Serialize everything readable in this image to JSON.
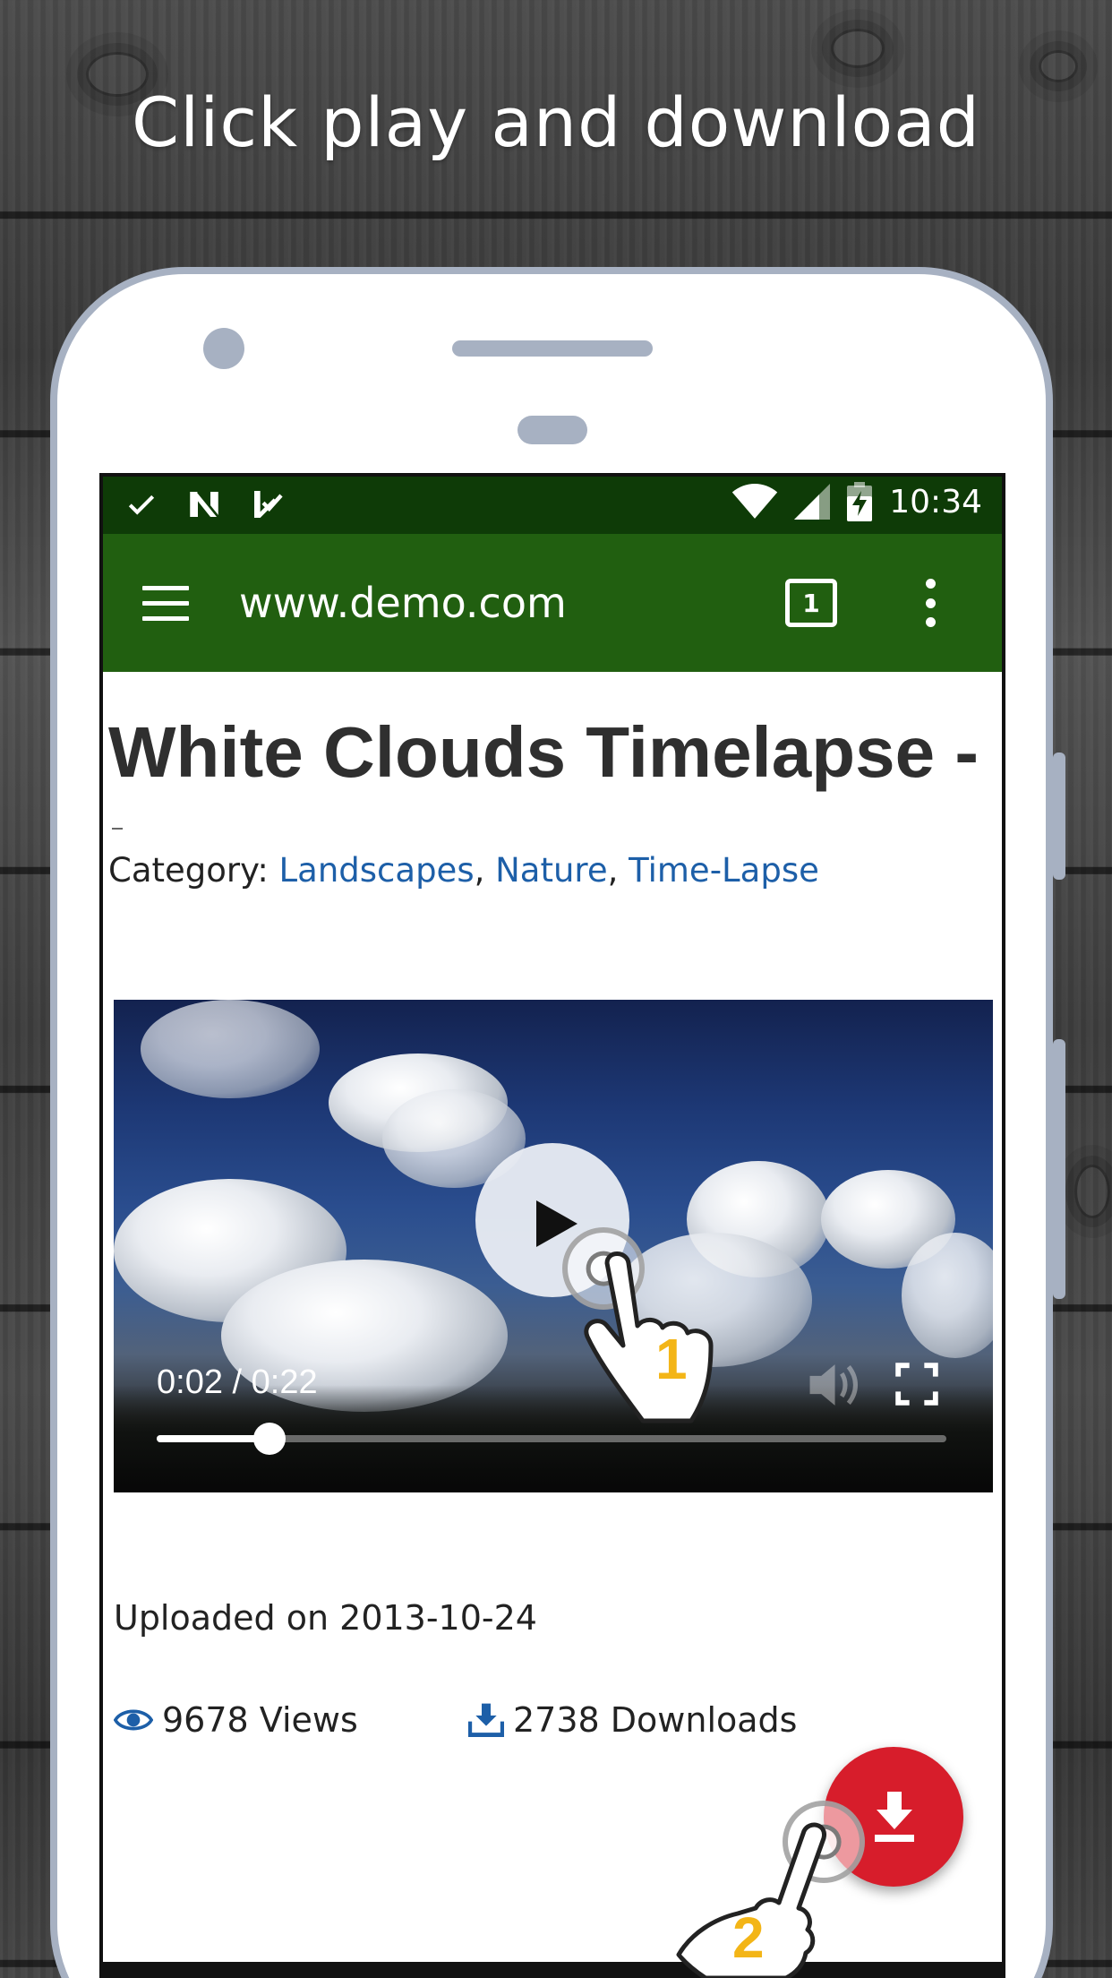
{
  "headline": "Click play and download",
  "status_bar": {
    "time": "10:34",
    "icons": [
      "check-icon",
      "n-logo-icon",
      "download-check-icon",
      "wifi-icon",
      "signal-icon",
      "battery-charging-icon"
    ]
  },
  "browser": {
    "url": "www.demo.com",
    "tab_count": "1",
    "menu_icon": "hamburger-menu-icon",
    "overflow_icon": "more-vertical-icon"
  },
  "page": {
    "title": "White Clouds Timelapse -",
    "category_label": "Category: ",
    "categories": [
      "Landscapes",
      "Nature",
      "Time-Lapse"
    ],
    "separator": ", ",
    "uploaded": "Uploaded on 2013-10-24",
    "views": "9678 Views",
    "downloads": "2738 Downloads"
  },
  "video_player": {
    "time": "0:02 / 0:22",
    "progress": 0.143,
    "controls": [
      "play-icon",
      "volume-icon",
      "fullscreen-icon"
    ]
  },
  "steps": {
    "step1": "1",
    "step2": "2"
  },
  "colors": {
    "status_bar": "#0e3b07",
    "toolbar": "#215f10",
    "link": "#1d5fa8",
    "fab": "#d71d2b",
    "step_number": "#f3b517",
    "phone_frame": "#a7b1c2"
  }
}
